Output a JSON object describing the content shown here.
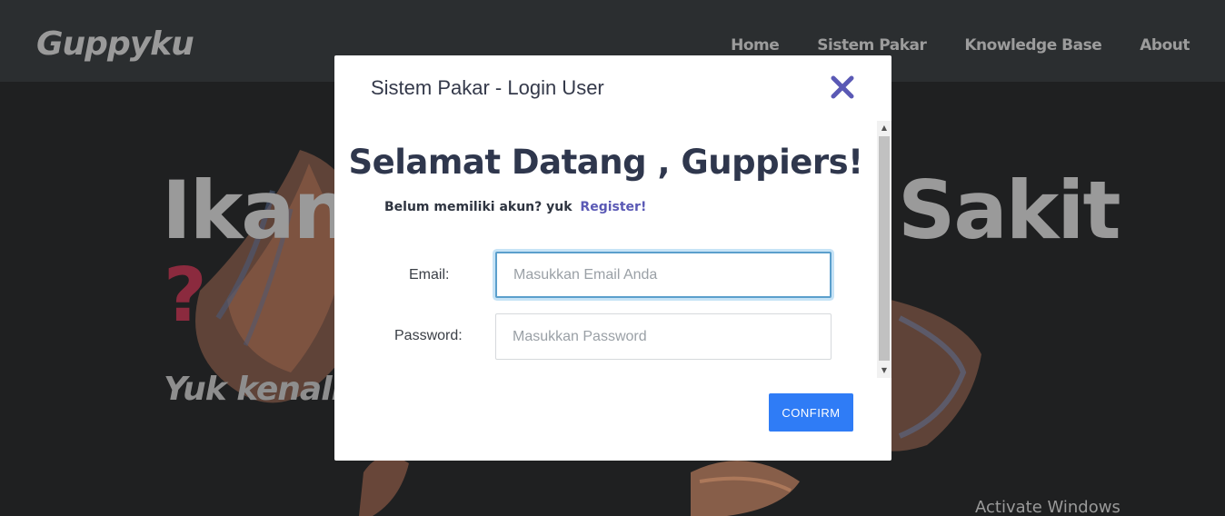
{
  "navbar": {
    "brand": "Guppyku",
    "links": [
      "Home",
      "Sistem Pakar",
      "Knowledge Base",
      "About"
    ]
  },
  "hero": {
    "title_left": "Ikan",
    "title_right": "Sakit",
    "question_mark": "?",
    "subtitle": "Yuk kenali p"
  },
  "modal": {
    "title": "Sistem Pakar - Login User",
    "close_icon": "close-icon",
    "welcome": "Selamat Datang , Guppiers!",
    "register_prompt": "Belum memiliki akun? yuk",
    "register_link": "Register!",
    "email_label": "Email:",
    "email_placeholder": "Masukkan Email Anda",
    "email_value": "",
    "password_label": "Password:",
    "password_placeholder": "Masukkan Password",
    "password_value": "",
    "confirm_label": "CONFIRM"
  },
  "system": {
    "watermark": "Activate Windows"
  },
  "colors": {
    "accent": "#5a59b5",
    "confirm": "#2f7cf6",
    "question": "#8b2a3e",
    "focus_ring": "#5b9fcc"
  }
}
